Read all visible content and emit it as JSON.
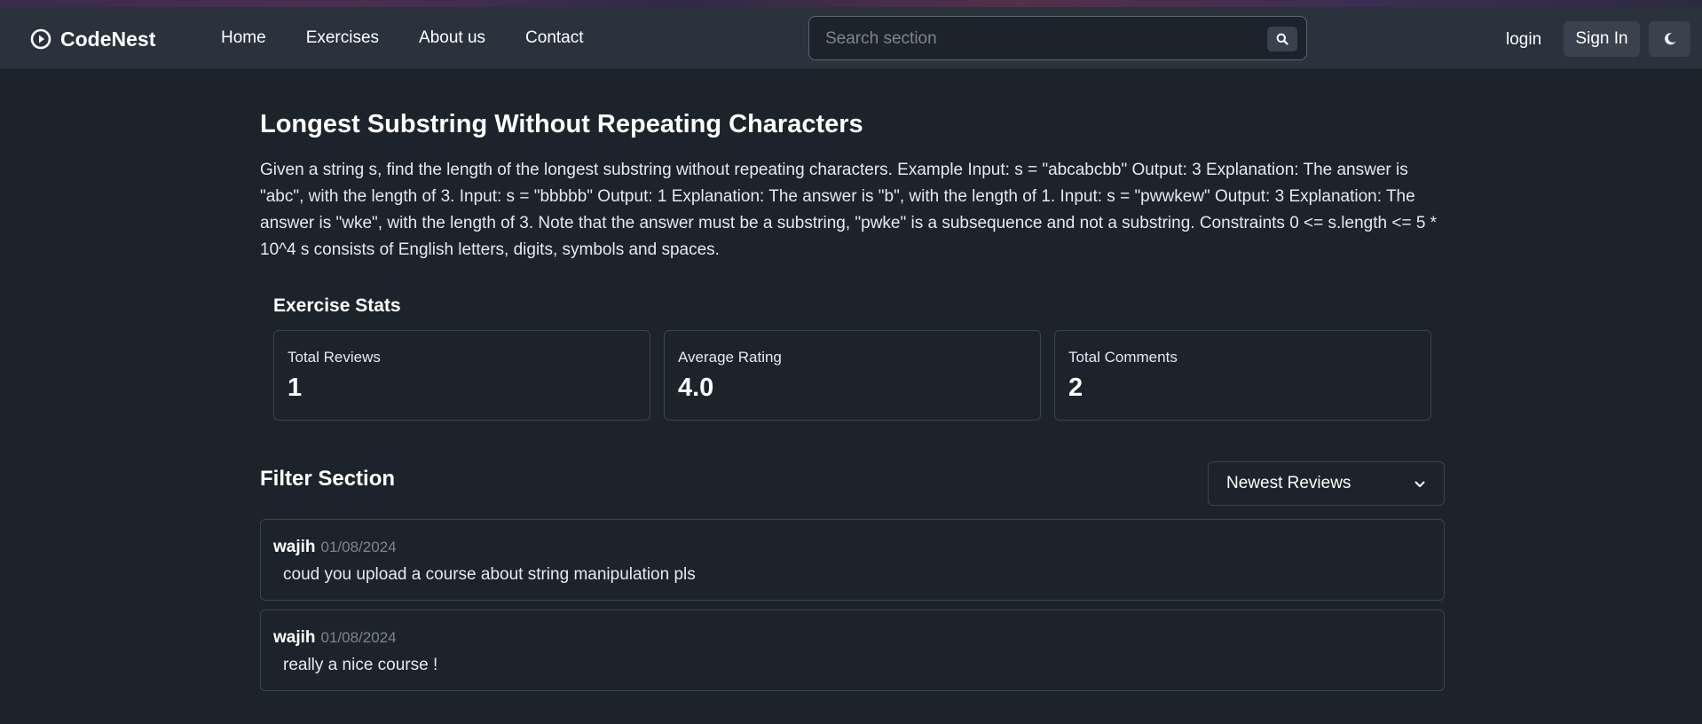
{
  "nav": {
    "brand": "CodeNest",
    "links": [
      "Home",
      "Exercises",
      "About us",
      "Contact"
    ],
    "search_placeholder": "Search section",
    "login": "login",
    "sign_in": "Sign In"
  },
  "exercise": {
    "title": "Longest Substring Without Repeating Characters",
    "description": "Given a string s, find the length of the longest substring without repeating characters. Example Input: s = \"abcabcbb\" Output: 3 Explanation: The answer is \"abc\", with the length of 3. Input: s = \"bbbbb\" Output: 1 Explanation: The answer is \"b\", with the length of 1. Input: s = \"pwwkew\" Output: 3 Explanation: The answer is \"wke\", with the length of 3. Note that the answer must be a substring, \"pwke\" is a subsequence and not a substring. Constraints 0 <= s.length <= 5 * 10^4 s consists of English letters, digits, symbols and spaces."
  },
  "stats": {
    "title": "Exercise Stats",
    "cards": [
      {
        "label": "Total Reviews",
        "value": "1"
      },
      {
        "label": "Average Rating",
        "value": "4.0"
      },
      {
        "label": "Total Comments",
        "value": "2"
      }
    ]
  },
  "filter": {
    "title": "Filter Section",
    "selected": "Newest Reviews"
  },
  "reviews": [
    {
      "user": "wajih",
      "date": "01/08/2024",
      "text": "coud you upload a course about string manipulation pls"
    },
    {
      "user": "wajih",
      "date": "01/08/2024",
      "text": "really a nice course !"
    }
  ]
}
